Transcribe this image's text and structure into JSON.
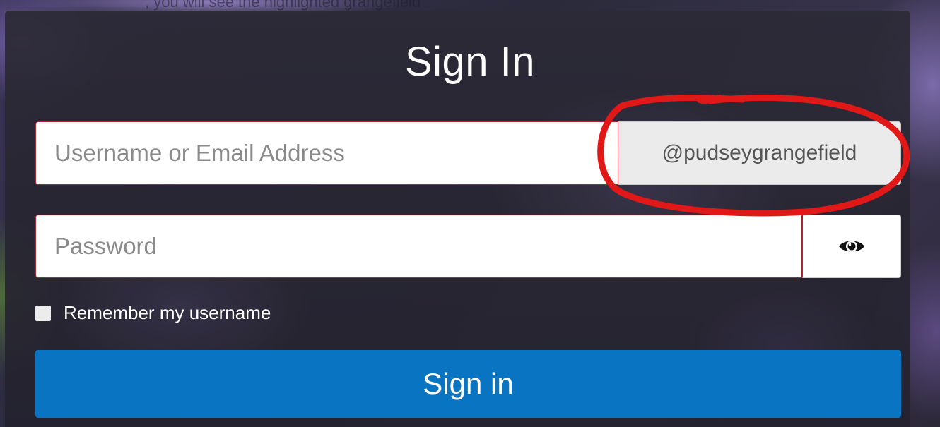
{
  "background_caption": ", you will see the highlighted grangefield",
  "form": {
    "title": "Sign In",
    "username_placeholder": "Username or Email Address",
    "username_value": "",
    "domain_suffix": "@pudseygrangefield",
    "password_placeholder": "Password",
    "password_value": "",
    "show_password_icon": "eye-icon",
    "remember_label": "Remember my username",
    "remember_checked": false,
    "submit_label": "Sign in"
  },
  "colors": {
    "submit_button": "#0874c2",
    "field_border": "#b3232f",
    "annotation_circle": "#e01818",
    "domain_addon_bg": "#ebebeb"
  },
  "annotation": {
    "shape": "hand-drawn-circle",
    "target": "domain_suffix"
  }
}
